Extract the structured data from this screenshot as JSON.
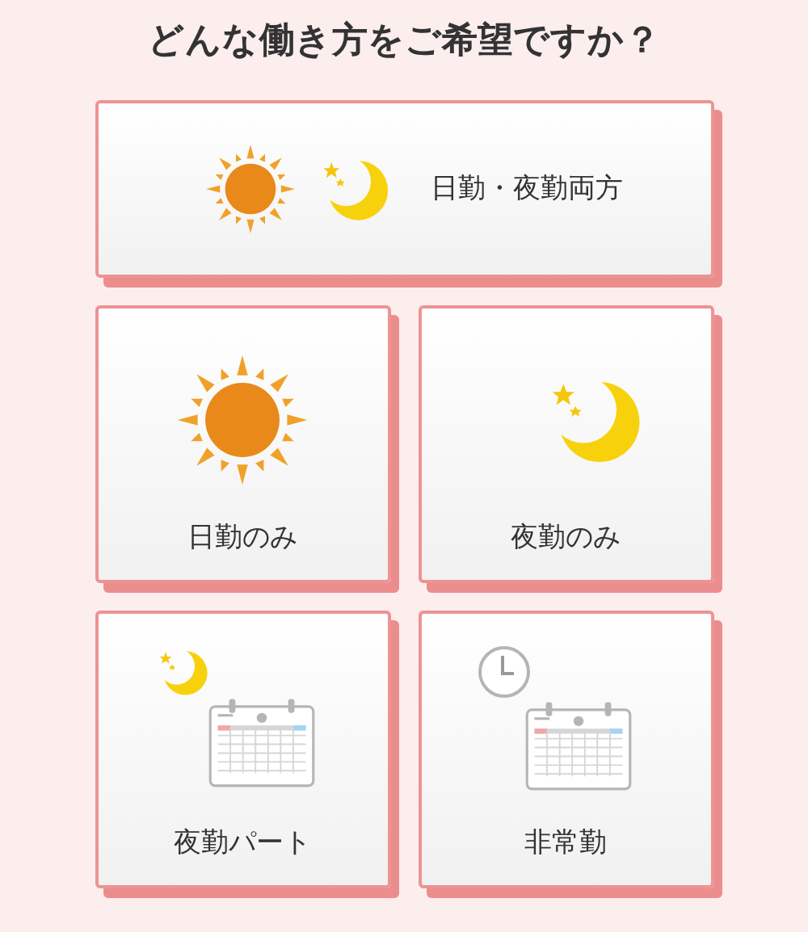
{
  "title": "どんな働き方をご希望ですか？",
  "options": [
    {
      "kind": "both",
      "label": "日勤・夜勤両方"
    },
    {
      "kind": "day",
      "label": "日勤のみ"
    },
    {
      "kind": "night",
      "label": "夜勤のみ"
    },
    {
      "kind": "night_part",
      "label": "夜勤パート"
    },
    {
      "kind": "non_regular",
      "label": "非常勤"
    }
  ]
}
